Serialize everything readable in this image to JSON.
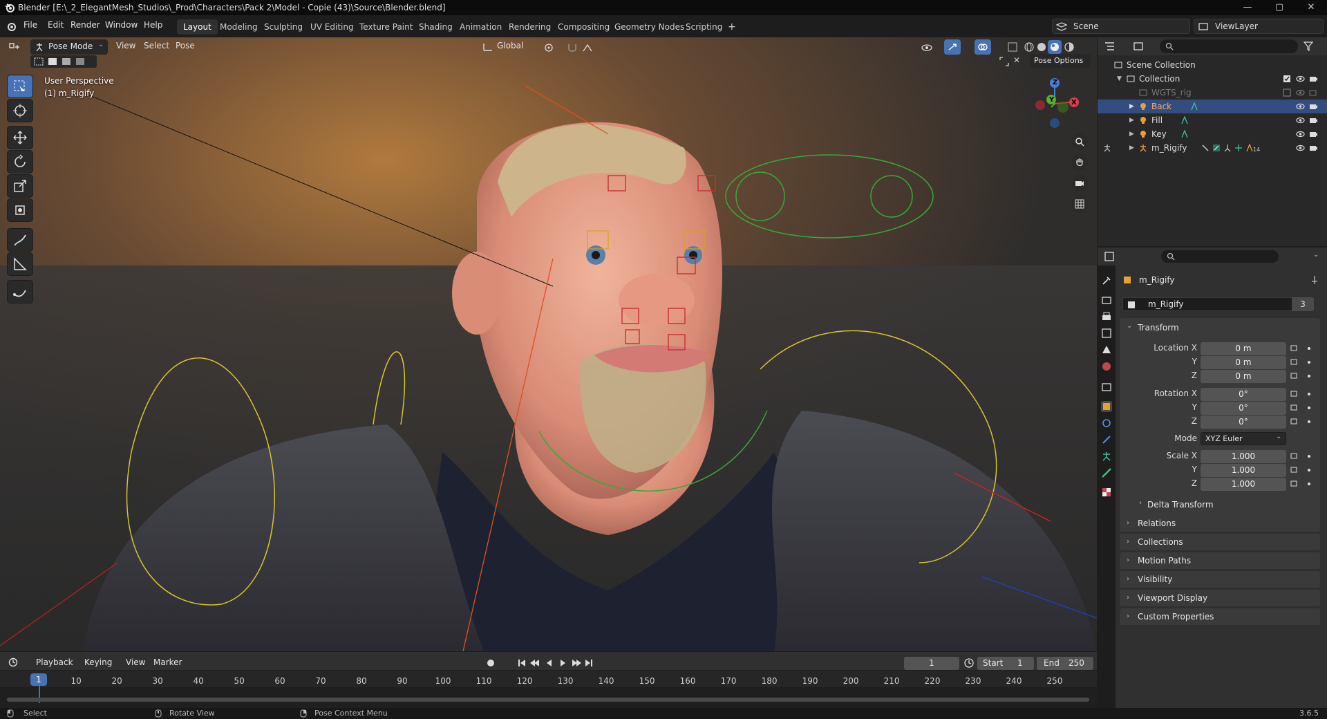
{
  "window": {
    "title": "Blender [E:\\_2_ElegantMesh_Studios\\_Prod\\Characters\\Pack 2\\Model - Copie (43)\\Source\\Blender.blend]",
    "controls": [
      "—",
      "▢",
      "✕"
    ]
  },
  "menu": {
    "items": [
      "File",
      "Edit",
      "Render",
      "Window",
      "Help"
    ]
  },
  "workspaces": {
    "tabs": [
      "Layout",
      "Modeling",
      "Sculpting",
      "UV Editing",
      "Texture Paint",
      "Shading",
      "Animation",
      "Rendering",
      "Compositing",
      "Geometry Nodes",
      "Scripting"
    ],
    "active": "Layout",
    "add": "+"
  },
  "scene": {
    "label": "Scene"
  },
  "viewlayer": {
    "label": "ViewLayer"
  },
  "viewport_header": {
    "mode": "Pose Mode",
    "view": "View",
    "select": "Select",
    "pose": "Pose",
    "orientation": "Global",
    "pose_options": "Pose Options"
  },
  "viewport": {
    "perspective": "User Perspective",
    "object": "(1) m_Rigify",
    "gizmo": {
      "z": "Z",
      "y": "Y",
      "x": "X"
    }
  },
  "outliner": {
    "root": "Scene Collection",
    "collection": "Collection",
    "items": [
      {
        "name": "WGTS_rig"
      },
      {
        "name": "Back"
      },
      {
        "name": "Fill"
      },
      {
        "name": "Key"
      },
      {
        "name": "m_Rigify"
      }
    ],
    "selected": "Back",
    "badge_count": "14"
  },
  "properties": {
    "object_name": "m_Rigify",
    "data_name": "m_Rigify",
    "data_users": "3",
    "transform_label": "Transform",
    "location_x_label": "Location X",
    "location": [
      "0 m",
      "0 m",
      "0 m"
    ],
    "rotation_x_label": "Rotation X",
    "rotation": [
      "0°",
      "0°",
      "0°"
    ],
    "y_label": "Y",
    "z_label": "Z",
    "mode_label": "Mode",
    "mode_value": "XYZ Euler",
    "scale_x_label": "Scale X",
    "scale": [
      "1.000",
      "1.000",
      "1.000"
    ],
    "delta": "Delta Transform",
    "panels": [
      "Relations",
      "Collections",
      "Motion Paths",
      "Visibility",
      "Viewport Display",
      "Custom Properties"
    ]
  },
  "timeline": {
    "playback": "Playback",
    "keying": "Keying",
    "view": "View",
    "marker": "Marker",
    "current_frame": "1",
    "start_label": "Start",
    "start": "1",
    "end_label": "End",
    "end": "250",
    "ticks": [
      "10",
      "20",
      "30",
      "40",
      "50",
      "60",
      "70",
      "80",
      "90",
      "100",
      "110",
      "120",
      "130",
      "140",
      "150",
      "160",
      "170",
      "180",
      "190",
      "200",
      "210",
      "220",
      "230",
      "240",
      "250"
    ],
    "playhead": "1"
  },
  "statusbar": {
    "select": "Select",
    "rotate": "Rotate View",
    "context": "Pose Context Menu",
    "version": "3.6.5"
  }
}
